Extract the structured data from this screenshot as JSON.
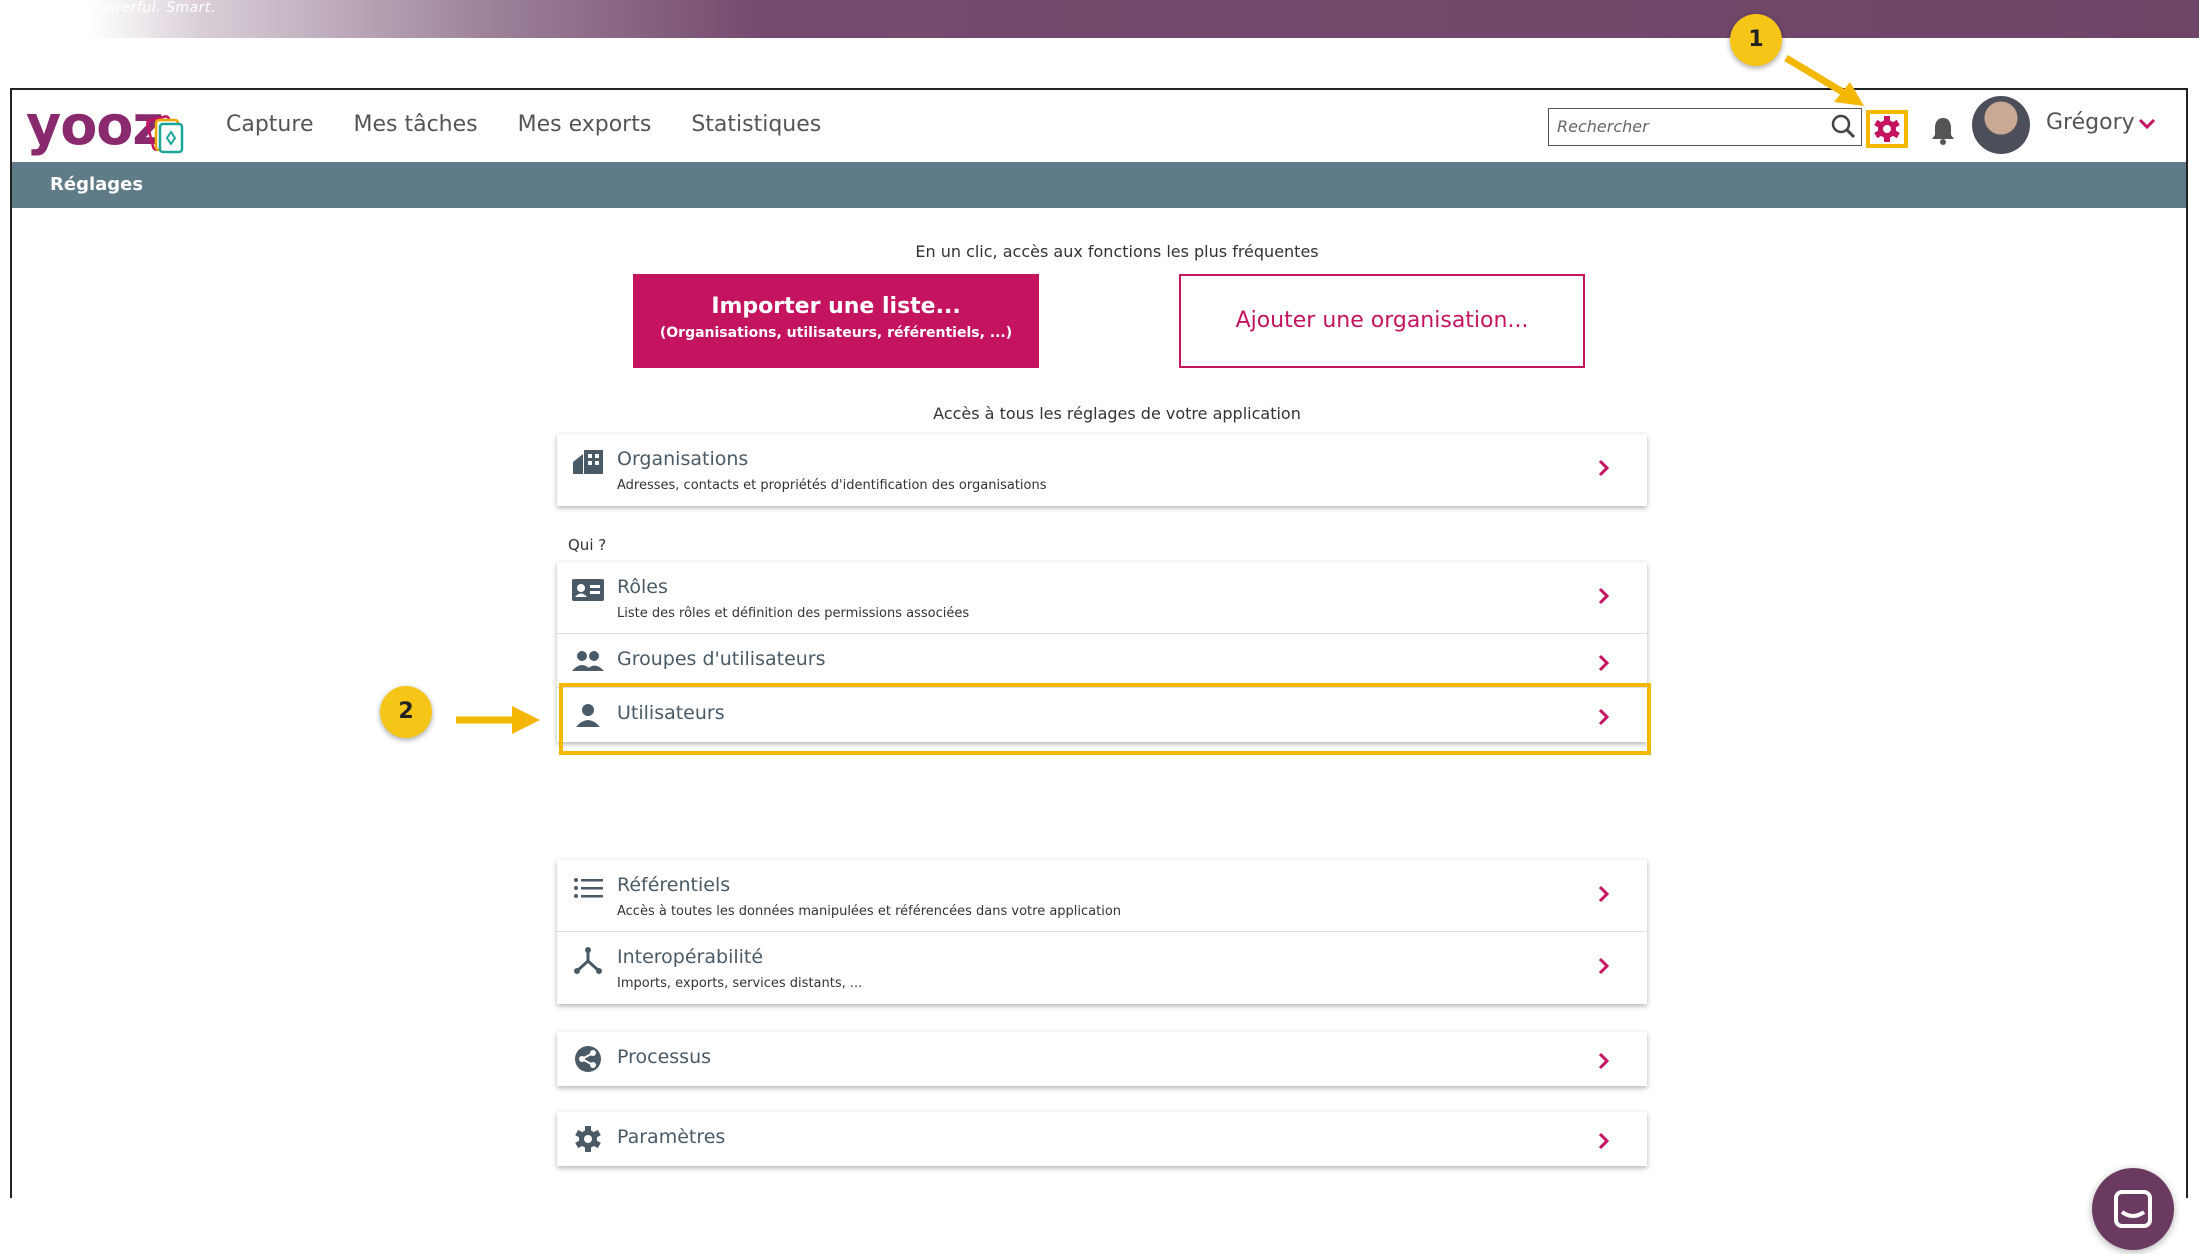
{
  "banner": {
    "text": "ation: easy. Powerful. Smart."
  },
  "header": {
    "logo_text": "yooz",
    "nav": [
      "Capture",
      "Mes tâches",
      "Mes exports",
      "Statistiques"
    ],
    "search_placeholder": "Rechercher",
    "username": "Grégory"
  },
  "settings_bar": {
    "title": "Réglages"
  },
  "quick": {
    "caption": "En un clic, accès aux fonctions les plus fréquentes",
    "import_title": "Importer une liste...",
    "import_subtitle": "(Organisations, utilisateurs, référentiels, ...)",
    "add_org": "Ajouter une organisation..."
  },
  "all_settings_caption": "Accès à tous les réglages de votre application",
  "sections": {
    "organisations": {
      "title": "Organisations",
      "desc": "Adresses, contacts et propriétés d'identification des organisations"
    },
    "qui_label": "Qui ?",
    "roles": {
      "title": "Rôles",
      "desc": "Liste des rôles et définition des permissions associées"
    },
    "groupes": {
      "title": "Groupes d'utilisateurs"
    },
    "utilisateurs": {
      "title": "Utilisateurs"
    },
    "referentiels": {
      "title": "Référentiels",
      "desc": "Accès à toutes les données manipulées et référencées dans votre application"
    },
    "interop": {
      "title": "Interopérabilité",
      "desc": "Imports, exports, services distants, ..."
    },
    "processus": {
      "title": "Processus"
    },
    "parametres": {
      "title": "Paramètres"
    }
  },
  "annotations": {
    "step1": "1",
    "step2": "2"
  },
  "colors": {
    "brand": "#8a2a6e",
    "primary": "#c4135f",
    "bar": "#607b88",
    "highlight": "#f5b800"
  }
}
